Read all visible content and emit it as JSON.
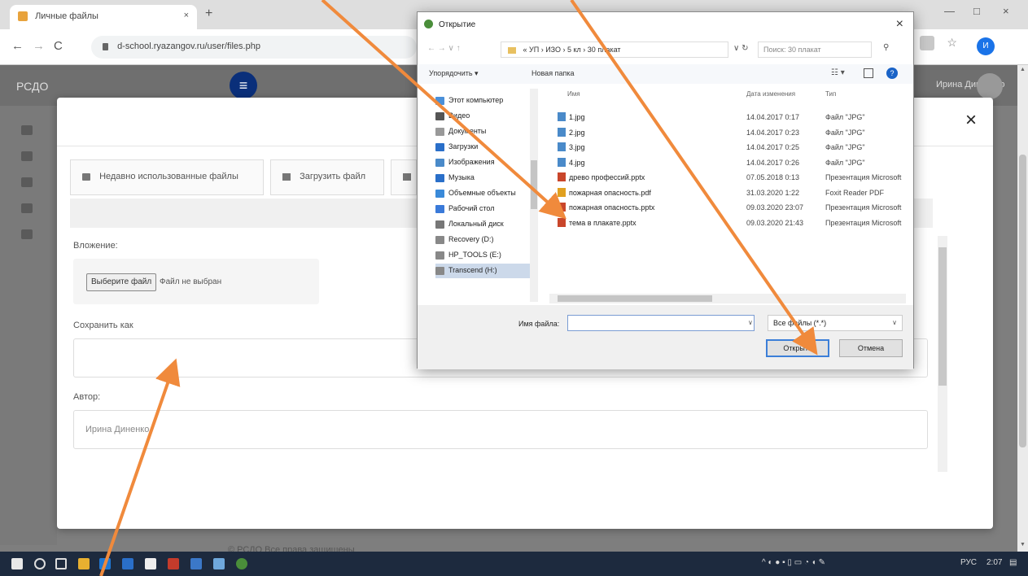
{
  "browser": {
    "tab_title": "Личные файлы",
    "tab_close": "×",
    "new_tab": "+",
    "url": "d-school.ryazangov.ru/user/files.php",
    "profile": "И",
    "min": "—",
    "max": "□",
    "close": "×"
  },
  "site": {
    "logo": "РСДО",
    "nav_button": "≡",
    "user_name": "Ирина Дин... нко",
    "footer": "© РСДО    Все права защищены"
  },
  "modal": {
    "close": "×",
    "nav": [
      {
        "label": "Недавно использованные файлы"
      },
      {
        "label": "Загрузить файл"
      }
    ],
    "attachment_label": "Вложение:",
    "choose_button": "Выберите файл",
    "no_file": "Файл не выбран",
    "save_as_label": "Сохранить как",
    "save_as_value": "",
    "author_label": "Автор:",
    "author_value": "Ирина Диненко"
  },
  "dialog": {
    "title": "Открытие",
    "close": "×",
    "path": "« УП › ИЗО › 5 кл › 30 плакат",
    "search_placeholder": "Поиск: 30 плакат",
    "organize": "Упорядочить ▾",
    "new_folder": "Новая папка",
    "columns": {
      "name": "Имя",
      "date": "Дата изменения",
      "type": "Тип"
    },
    "tree": [
      {
        "label": "Этот компьютер",
        "color": "#4a90d9"
      },
      {
        "label": "Видео",
        "color": "#555555"
      },
      {
        "label": "Документы",
        "color": "#999999"
      },
      {
        "label": "Загрузки",
        "color": "#2a6fc9"
      },
      {
        "label": "Изображения",
        "color": "#4a8ac9"
      },
      {
        "label": "Музыка",
        "color": "#2a6fc9"
      },
      {
        "label": "Объемные объекты",
        "color": "#3a8ad9"
      },
      {
        "label": "Рабочий стол",
        "color": "#3a7ad9"
      },
      {
        "label": "Локальный диск",
        "color": "#777777"
      },
      {
        "label": "Recovery (D:)",
        "color": "#888888"
      },
      {
        "label": "HP_TOOLS (E:)",
        "color": "#888888"
      },
      {
        "label": "Transcend (H:)",
        "color": "#888888"
      }
    ],
    "files": [
      {
        "name": "1.jpg",
        "date": "14.04.2017 0:17",
        "type": "Файл \"JPG\"",
        "color": "#4a8ac9"
      },
      {
        "name": "2.jpg",
        "date": "14.04.2017 0:23",
        "type": "Файл \"JPG\"",
        "color": "#4a8ac9"
      },
      {
        "name": "3.jpg",
        "date": "14.04.2017 0:25",
        "type": "Файл \"JPG\"",
        "color": "#4a8ac9"
      },
      {
        "name": "4.jpg",
        "date": "14.04.2017 0:26",
        "type": "Файл \"JPG\"",
        "color": "#4a8ac9"
      },
      {
        "name": "древо профессий.pptx",
        "date": "07.05.2018 0:13",
        "type": "Презентация Microsoft",
        "color": "#c9462b"
      },
      {
        "name": "пожарная опасность.pdf",
        "date": "31.03.2020 1:22",
        "type": "Foxit Reader PDF",
        "color": "#e0a020"
      },
      {
        "name": "пожарная опасность.pptx",
        "date": "09.03.2020 23:07",
        "type": "Презентация Microsoft",
        "color": "#c9462b"
      },
      {
        "name": "тема в плакате.pptx",
        "date": "09.03.2020 21:43",
        "type": "Презентация Microsoft",
        "color": "#c9462b"
      }
    ],
    "filename_label": "Имя файла:",
    "filename_value": "",
    "filetype": "Все файлы (*.*)",
    "open_button": "Открыть",
    "cancel_button": "Отмена"
  },
  "taskbar": {
    "lang": "РУС",
    "time": "2:07"
  },
  "colors": {
    "arrow": "#f08a3c",
    "accent": "#0a2f7a"
  }
}
